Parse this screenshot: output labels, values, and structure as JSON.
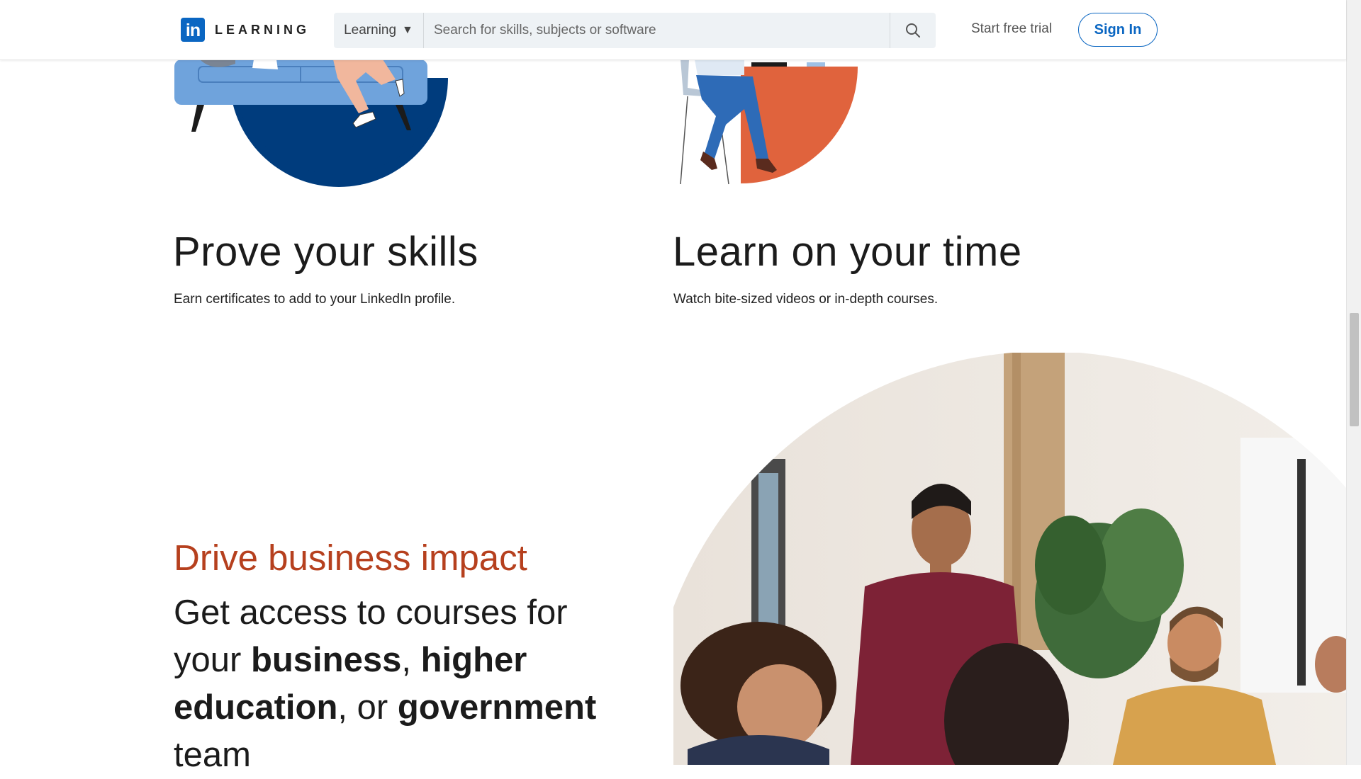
{
  "header": {
    "logo_mark": "in",
    "logo_text": "LEARNING",
    "search_scope_label": "Learning",
    "search_placeholder": "Search for skills, subjects or software",
    "search_value": "",
    "start_trial_label": "Start free trial",
    "sign_in_label": "Sign In"
  },
  "features": [
    {
      "title": "Prove your skills",
      "description": "Earn certificates to add to your LinkedIn profile."
    },
    {
      "title": "Learn on your time",
      "description": "Watch bite-sized videos or in-depth courses."
    }
  ],
  "impact": {
    "heading": "Drive business impact",
    "body_prefix": "Get access to courses for your ",
    "business": "business",
    "sep1": ", ",
    "higher_education": "higher education",
    "sep2": ", or ",
    "government": "government",
    "suffix": " team"
  },
  "colors": {
    "brand_blue": "#0a66c2",
    "impact_heading": "#b6401e",
    "illustration_navy": "#003c7d",
    "illustration_orange": "#e0633d",
    "couch_blue": "#6fa3dc"
  },
  "icons": {
    "search": "search-icon",
    "caret": "caret-down-icon"
  }
}
